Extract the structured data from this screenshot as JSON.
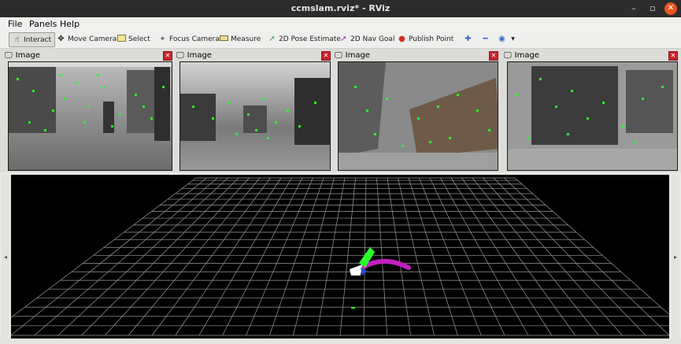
{
  "window": {
    "title": "ccmslam.rviz* - RViz",
    "minimize_glyph": "–",
    "maximize_glyph": "▫",
    "close_glyph": "✕"
  },
  "menu": [
    "File",
    "Panels",
    "Help"
  ],
  "toolbar": {
    "interact": "Interact",
    "move_camera": "Move Camera",
    "select": "Select",
    "focus_camera": "Focus Camera",
    "measure": "Measure",
    "pose_estimate": "2D Pose Estimate",
    "nav_goal": "2D Nav Goal",
    "publish_point": "Publish Point"
  },
  "panels": [
    {
      "title": "Image",
      "close_glyph": "✕"
    },
    {
      "title": "Image",
      "close_glyph": "✕"
    },
    {
      "title": "Image",
      "close_glyph": "✕"
    },
    {
      "title": "Image",
      "close_glyph": "✕"
    }
  ],
  "side_arrows": {
    "left": "◂",
    "right": "▸"
  },
  "colors": {
    "feature_points": "#2aff2a",
    "grid": "#9a9a9a",
    "trajectory": "#c020c0",
    "active_tool": "#dcdcd8",
    "close_button": "#e95420"
  }
}
